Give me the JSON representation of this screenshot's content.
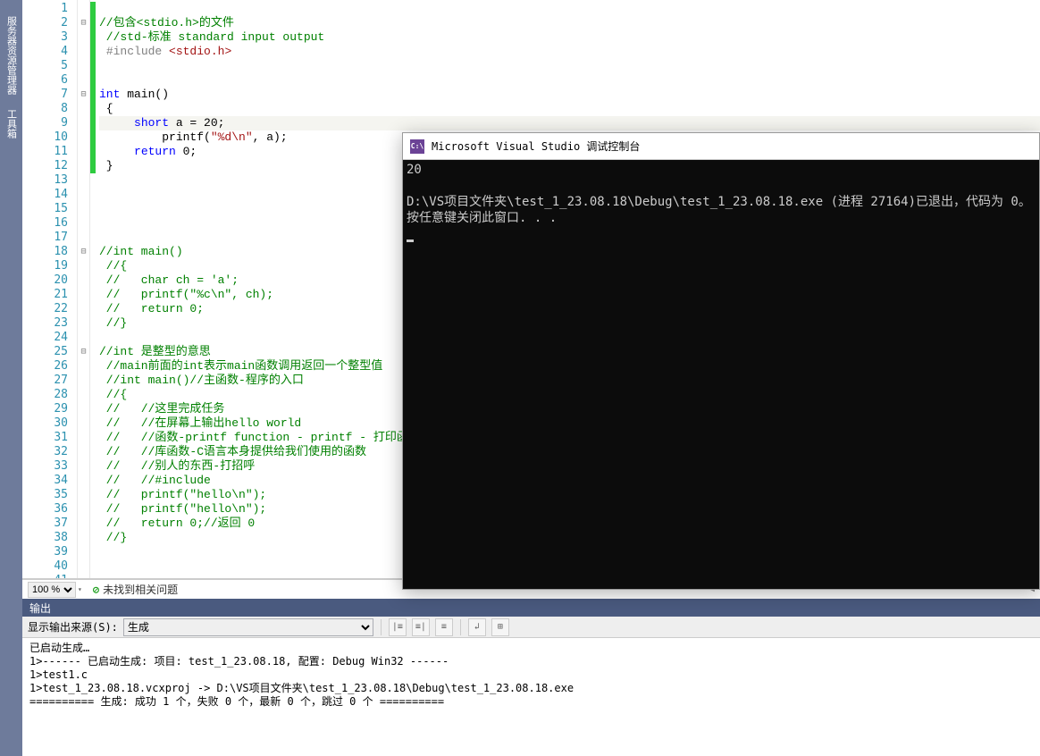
{
  "leftbar": {
    "tabs": [
      "服务器资源管理器",
      "工具箱"
    ]
  },
  "editor": {
    "zoom": "100 %",
    "issues": "未找到相关问题",
    "lines": [
      {
        "n": 1,
        "fold": "",
        "chg": "g",
        "segs": []
      },
      {
        "n": 2,
        "fold": "⊟",
        "chg": "g",
        "segs": [
          {
            "t": "//包含<stdio.h>的文件",
            "c": "c-green"
          }
        ]
      },
      {
        "n": 3,
        "fold": "",
        "chg": "g",
        "segs": [
          {
            "t": " //std-标准 standard input output",
            "c": "c-green"
          }
        ]
      },
      {
        "n": 4,
        "fold": "",
        "chg": "g",
        "segs": [
          {
            "t": " ",
            "c": "c-black"
          },
          {
            "t": "#include ",
            "c": "c-gray"
          },
          {
            "t": "<stdio.h>",
            "c": "c-red"
          }
        ]
      },
      {
        "n": 5,
        "fold": "",
        "chg": "g",
        "segs": []
      },
      {
        "n": 6,
        "fold": "",
        "chg": "g",
        "segs": []
      },
      {
        "n": 7,
        "fold": "⊟",
        "chg": "g",
        "segs": [
          {
            "t": "int",
            "c": "c-blue"
          },
          {
            "t": " main()",
            "c": "c-black"
          }
        ]
      },
      {
        "n": 8,
        "fold": "",
        "chg": "g",
        "segs": [
          {
            "t": " {",
            "c": "c-black"
          }
        ]
      },
      {
        "n": 9,
        "fold": "",
        "chg": "g",
        "hl": true,
        "segs": [
          {
            "t": "     ",
            "c": "c-black"
          },
          {
            "t": "short",
            "c": "c-blue"
          },
          {
            "t": " a = 20;",
            "c": "c-black"
          }
        ]
      },
      {
        "n": 10,
        "fold": "",
        "chg": "g",
        "segs": [
          {
            "t": "         printf(",
            "c": "c-black"
          },
          {
            "t": "\"%d\\n\"",
            "c": "c-red"
          },
          {
            "t": ", a);",
            "c": "c-black"
          }
        ]
      },
      {
        "n": 11,
        "fold": "",
        "chg": "g",
        "segs": [
          {
            "t": "     ",
            "c": "c-black"
          },
          {
            "t": "return",
            "c": "c-blue"
          },
          {
            "t": " 0;",
            "c": "c-black"
          }
        ]
      },
      {
        "n": 12,
        "fold": "",
        "chg": "g",
        "segs": [
          {
            "t": " }",
            "c": "c-black"
          }
        ]
      },
      {
        "n": 13,
        "fold": "",
        "chg": "",
        "segs": []
      },
      {
        "n": 14,
        "fold": "",
        "chg": "",
        "segs": []
      },
      {
        "n": 15,
        "fold": "",
        "chg": "",
        "segs": []
      },
      {
        "n": 16,
        "fold": "",
        "chg": "",
        "segs": []
      },
      {
        "n": 17,
        "fold": "",
        "chg": "",
        "segs": []
      },
      {
        "n": 18,
        "fold": "⊟",
        "chg": "",
        "segs": [
          {
            "t": "//int main()",
            "c": "c-green"
          }
        ]
      },
      {
        "n": 19,
        "fold": "",
        "chg": "",
        "segs": [
          {
            "t": " //{",
            "c": "c-green"
          }
        ]
      },
      {
        "n": 20,
        "fold": "",
        "chg": "",
        "segs": [
          {
            "t": " //   char ch = 'a';",
            "c": "c-green"
          }
        ]
      },
      {
        "n": 21,
        "fold": "",
        "chg": "",
        "segs": [
          {
            "t": " //   printf(\"%c\\n\", ch);",
            "c": "c-green"
          }
        ]
      },
      {
        "n": 22,
        "fold": "",
        "chg": "",
        "segs": [
          {
            "t": " //   return 0;",
            "c": "c-green"
          }
        ]
      },
      {
        "n": 23,
        "fold": "",
        "chg": "",
        "segs": [
          {
            "t": " //}",
            "c": "c-green"
          }
        ]
      },
      {
        "n": 24,
        "fold": "",
        "chg": "",
        "segs": []
      },
      {
        "n": 25,
        "fold": "⊟",
        "chg": "",
        "segs": [
          {
            "t": "//int 是整型的意思",
            "c": "c-green"
          }
        ]
      },
      {
        "n": 26,
        "fold": "",
        "chg": "",
        "segs": [
          {
            "t": " //main前面的int表示main函数调用返回一个整型值",
            "c": "c-green"
          }
        ]
      },
      {
        "n": 27,
        "fold": "",
        "chg": "",
        "segs": [
          {
            "t": " //int main()//主函数-程序的入口",
            "c": "c-green"
          }
        ]
      },
      {
        "n": 28,
        "fold": "",
        "chg": "",
        "segs": [
          {
            "t": " //{",
            "c": "c-green"
          }
        ]
      },
      {
        "n": 29,
        "fold": "",
        "chg": "",
        "segs": [
          {
            "t": " //   //这里完成任务",
            "c": "c-green"
          }
        ]
      },
      {
        "n": 30,
        "fold": "",
        "chg": "",
        "segs": [
          {
            "t": " //   //在屏幕上输出hello world",
            "c": "c-green"
          }
        ]
      },
      {
        "n": 31,
        "fold": "",
        "chg": "",
        "segs": [
          {
            "t": " //   //函数-printf function - printf - 打印函数",
            "c": "c-green"
          }
        ]
      },
      {
        "n": 32,
        "fold": "",
        "chg": "",
        "segs": [
          {
            "t": " //   //库函数-C语言本身提供给我们使用的函数",
            "c": "c-green"
          }
        ]
      },
      {
        "n": 33,
        "fold": "",
        "chg": "",
        "segs": [
          {
            "t": " //   //别人的东西-打招呼",
            "c": "c-green"
          }
        ]
      },
      {
        "n": 34,
        "fold": "",
        "chg": "",
        "segs": [
          {
            "t": " //   //#include",
            "c": "c-green"
          }
        ]
      },
      {
        "n": 35,
        "fold": "",
        "chg": "",
        "segs": [
          {
            "t": " //   printf(\"hello\\n\");",
            "c": "c-green"
          }
        ]
      },
      {
        "n": 36,
        "fold": "",
        "chg": "",
        "segs": [
          {
            "t": " //   printf(\"hello\\n\");",
            "c": "c-green"
          }
        ]
      },
      {
        "n": 37,
        "fold": "",
        "chg": "",
        "segs": [
          {
            "t": " //   return 0;//返回 0",
            "c": "c-green"
          }
        ]
      },
      {
        "n": 38,
        "fold": "",
        "chg": "",
        "segs": [
          {
            "t": " //}",
            "c": "c-green"
          }
        ]
      },
      {
        "n": 39,
        "fold": "",
        "chg": "",
        "segs": []
      },
      {
        "n": 40,
        "fold": "",
        "chg": "",
        "segs": []
      },
      {
        "n": 41,
        "fold": "",
        "chg": "",
        "segs": []
      }
    ]
  },
  "console": {
    "title": "Microsoft Visual Studio 调试控制台",
    "lines": [
      "20",
      "",
      "D:\\VS项目文件夹\\test_1_23.08.18\\Debug\\test_1_23.08.18.exe (进程 27164)已退出，代码为 0。",
      "按任意键关闭此窗口. . ."
    ]
  },
  "output": {
    "panel_title": "输出",
    "source_label": "显示输出来源(S):",
    "source_value": "生成",
    "lines": [
      "已启动生成…",
      "1>------ 已启动生成: 项目: test_1_23.08.18, 配置: Debug Win32 ------",
      "1>test1.c",
      "1>test_1_23.08.18.vcxproj -> D:\\VS项目文件夹\\test_1_23.08.18\\Debug\\test_1_23.08.18.exe",
      "========== 生成: 成功 1 个，失败 0 个，最新 0 个，跳过 0 个 =========="
    ]
  }
}
